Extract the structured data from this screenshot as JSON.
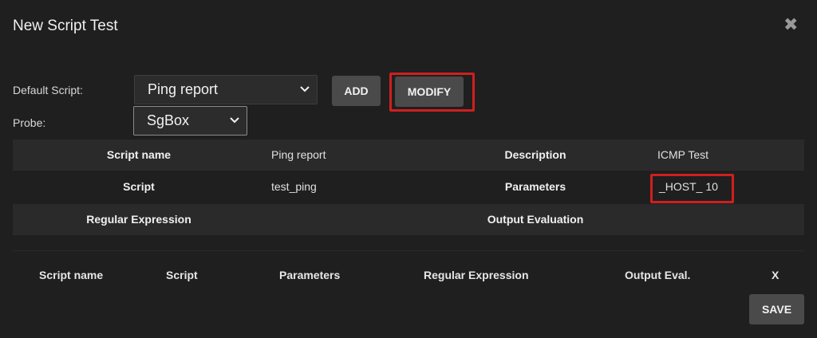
{
  "dialog": {
    "title": "New Script Test",
    "close_symbol": "✖"
  },
  "form": {
    "default_script_label": "Default Script:",
    "default_script_value": "Ping report",
    "probe_label": "Probe:",
    "probe_value": "SgBox",
    "add_label": "ADD",
    "modify_label": "MODIFY"
  },
  "details": {
    "script_name_label": "Script name",
    "script_name_value": "Ping report",
    "description_label": "Description",
    "description_value": "ICMP Test",
    "script_label": "Script",
    "script_value": "test_ping",
    "parameters_label": "Parameters",
    "parameters_value": "_HOST_ 10",
    "regex_label": "Regular Expression",
    "output_eval_label": "Output Evaluation"
  },
  "list": {
    "columns": [
      "Script name",
      "Script",
      "Parameters",
      "Regular Expression",
      "Output Eval.",
      "X"
    ]
  },
  "footer": {
    "save_label": "SAVE"
  },
  "colors": {
    "highlight": "#d01f1f",
    "background": "#1f1f1f",
    "button": "#4a4a4a"
  },
  "icons": {
    "close": "close-icon",
    "dropdown": "chevron-down-icon"
  }
}
